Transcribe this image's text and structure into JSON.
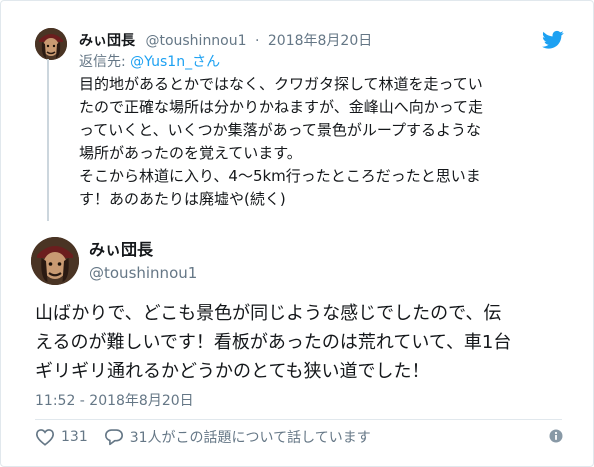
{
  "parent_tweet": {
    "author_name": "みぃ団長",
    "author_handle": "@toushinnou1",
    "separator": "·",
    "date": "2018年8月20日",
    "reply_prefix": "返信先: ",
    "reply_to": "@Yus1n_さん",
    "text_lines": [
      "目的地があるとかではなく、クワガタ探して林道を走ってい",
      "たので正確な場所は分かりかねますが、金峰山へ向かって走",
      "っていくと、いくつか集落があって景色がループするような",
      "場所があったのを覚えています。",
      "そこから林道に入り、4〜5km行ったところだったと思いま",
      "す！あのあたりは廃墟や(続く)"
    ]
  },
  "main_tweet": {
    "author_name": "みぃ団長",
    "author_handle": "@toushinnou1",
    "text_lines": [
      "山ばかりで、どこも景色が同じような感じでしたので、伝",
      "えるのが難しいです！看板があったのは荒れていて、車1台",
      "ギリギリ通れるかどうかのとても狭い道でした！"
    ],
    "timestamp": "11:52 - 2018年8月20日",
    "likes": "131",
    "replies_label": "31人がこの話題について話しています"
  },
  "icons": {
    "brand": "twitter-bird-icon",
    "like": "heart-icon",
    "reply": "speech-bubble-icon",
    "info": "info-icon"
  },
  "colors": {
    "brand_blue": "#1da1f2",
    "text": "#14171a",
    "muted": "#657786",
    "border": "#e1e8ed"
  }
}
